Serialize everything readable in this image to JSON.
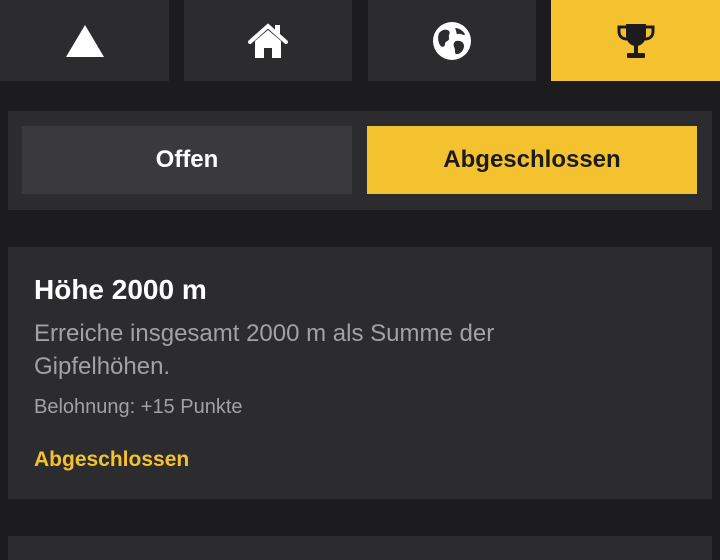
{
  "nav": {
    "tabs": [
      {
        "icon": "triangle-icon"
      },
      {
        "icon": "home-icon"
      },
      {
        "icon": "globe-icon"
      },
      {
        "icon": "trophy-icon"
      }
    ],
    "active_tab": 3,
    "accent_color": "#f4c22f"
  },
  "segment": {
    "open_label": "Offen",
    "completed_label": "Abgeschlossen",
    "selected": "Abgeschlossen"
  },
  "achievement": {
    "title": "Höhe 2000 m",
    "description": "Erreiche insgesamt 2000 m als Summe der Gipfelhöhen.",
    "reward": "Belohnung: +15 Punkte",
    "status": "Abgeschlossen"
  }
}
